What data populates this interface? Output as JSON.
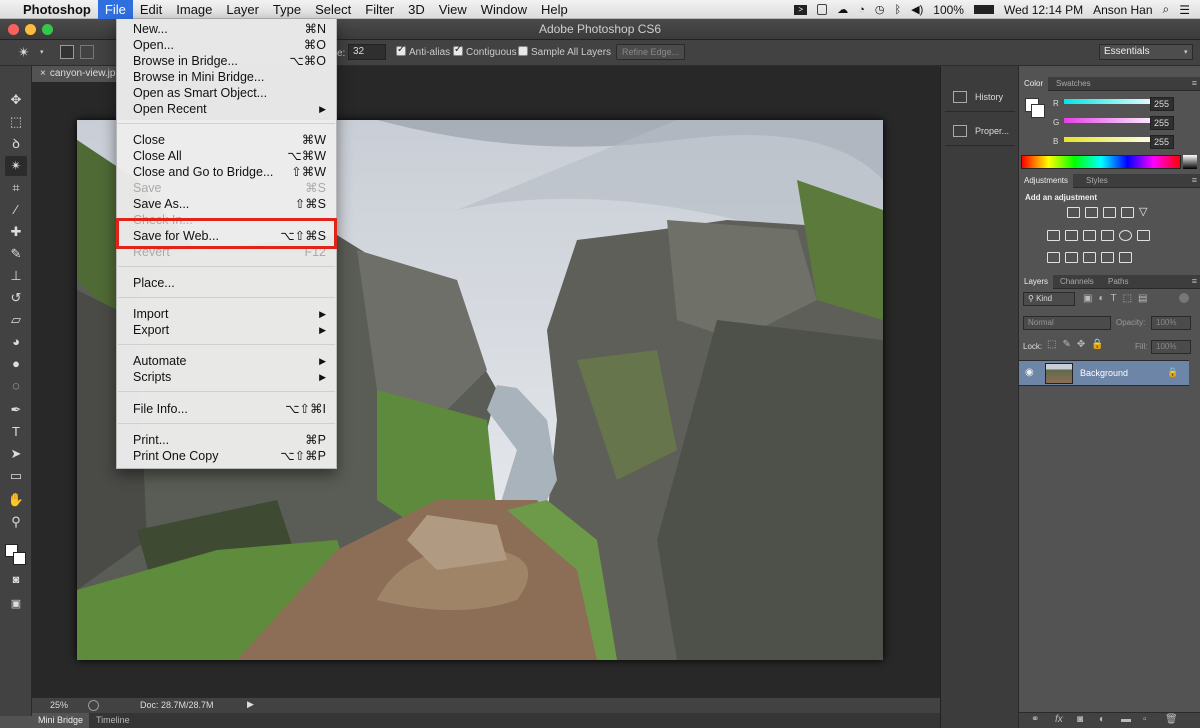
{
  "menubar": {
    "apple": "",
    "app_name": "Photoshop",
    "items": [
      "File",
      "Edit",
      "Image",
      "Layer",
      "Type",
      "Select",
      "Filter",
      "3D",
      "View",
      "Window",
      "Help"
    ],
    "active_item": "File",
    "status": {
      "battery": "100%",
      "clock": "Wed 12:14 PM",
      "user": "Anson Han"
    }
  },
  "window": {
    "title": "Adobe Photoshop CS6"
  },
  "options_bar": {
    "tolerance_label": "e:",
    "tolerance_value": "32",
    "anti_alias": "Anti-alias",
    "contiguous": "Contiguous",
    "sample_all_layers": "Sample All Layers",
    "refine_edge": "Refine Edge...",
    "workspace": "Essentials"
  },
  "document": {
    "tab_label": "canyon-view.jp",
    "zoom": "25%",
    "doc_size": "Doc: 28.7M/28.7M"
  },
  "bottom_tabs": [
    "Mini Bridge",
    "Timeline"
  ],
  "dock": {
    "history": "History",
    "properties": "Proper..."
  },
  "color_panel": {
    "tabs": [
      "Color",
      "Swatches"
    ],
    "channels": [
      {
        "label": "R",
        "value": "255",
        "color": "#00e5e5"
      },
      {
        "label": "G",
        "value": "255",
        "color": "#e540e5"
      },
      {
        "label": "B",
        "value": "255",
        "color": "#e5e520"
      }
    ]
  },
  "adjustments_panel": {
    "tabs": [
      "Adjustments",
      "Styles"
    ],
    "heading": "Add an adjustment"
  },
  "layers_panel": {
    "tabs": [
      "Layers",
      "Channels",
      "Paths"
    ],
    "filter_kind": "Kind",
    "blend_mode": "Normal",
    "opacity_label": "Opacity:",
    "opacity_value": "100%",
    "lock_label": "Lock:",
    "fill_label": "Fill:",
    "fill_value": "100%",
    "layers": [
      {
        "name": "Background"
      }
    ]
  },
  "file_menu": {
    "items": [
      {
        "label": "New...",
        "shortcut": "⌘N"
      },
      {
        "label": "Open...",
        "shortcut": "⌘O"
      },
      {
        "label": "Browse in Bridge...",
        "shortcut": "⌥⌘O"
      },
      {
        "label": "Browse in Mini Bridge...",
        "shortcut": ""
      },
      {
        "label": "Open as Smart Object...",
        "shortcut": ""
      },
      {
        "label": "Open Recent",
        "shortcut": ""
      },
      {
        "label": "Close",
        "shortcut": "⌘W"
      },
      {
        "label": "Close All",
        "shortcut": "⌥⌘W"
      },
      {
        "label": "Close and Go to Bridge...",
        "shortcut": "⇧⌘W"
      },
      {
        "label": "Save",
        "shortcut": "⌘S"
      },
      {
        "label": "Save As...",
        "shortcut": "⇧⌘S"
      },
      {
        "label": "Check In...",
        "shortcut": ""
      },
      {
        "label": "Save for Web...",
        "shortcut": "⌥⇧⌘S"
      },
      {
        "label": "Revert",
        "shortcut": "F12"
      },
      {
        "label": "Place...",
        "shortcut": ""
      },
      {
        "label": "Import",
        "shortcut": ""
      },
      {
        "label": "Export",
        "shortcut": ""
      },
      {
        "label": "Automate",
        "shortcut": ""
      },
      {
        "label": "Scripts",
        "shortcut": ""
      },
      {
        "label": "File Info...",
        "shortcut": "⌥⇧⌘I"
      },
      {
        "label": "Print...",
        "shortcut": "⌘P"
      },
      {
        "label": "Print One Copy",
        "shortcut": "⌥⇧⌘P"
      }
    ]
  },
  "colors": {
    "highlight": "#e0241a",
    "menu_active": "#2f6fe0"
  }
}
